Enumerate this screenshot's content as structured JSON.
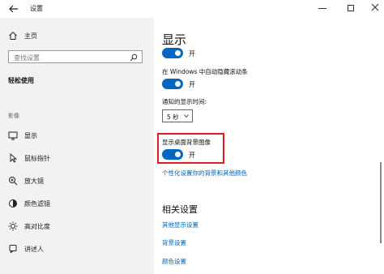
{
  "window": {
    "title": "设置"
  },
  "sidebar": {
    "home_label": "主页",
    "search_placeholder": "查找设置",
    "section_title": "轻松使用",
    "group_label": "影像",
    "items": [
      {
        "label": "显示",
        "icon": "monitor-icon"
      },
      {
        "label": "鼠标指针",
        "icon": "mouse-pointer-icon"
      },
      {
        "label": "放大镜",
        "icon": "magnifier-icon"
      },
      {
        "label": "颜色滤镜",
        "icon": "color-filter-icon"
      },
      {
        "label": "高对比度",
        "icon": "contrast-icon"
      },
      {
        "label": "讲述人",
        "icon": "narrator-icon"
      }
    ]
  },
  "main": {
    "title": "显示",
    "toggle1_state": "开",
    "scrollbar_setting_label": "在 Windows 中自动隐藏滚动条",
    "toggle2_state": "开",
    "notification_label": "通知的显示时间:",
    "notification_value": "5 秒",
    "background_label": "显示桌面背景图像",
    "toggle3_state": "开",
    "personalize_link": "个性化设置你的背景和其他颜色",
    "related_title": "相关设置",
    "related_links": [
      "其他显示设置",
      "背景设置",
      "颜色设置"
    ]
  },
  "colors": {
    "accent": "#0067c0",
    "link": "#0063b1",
    "highlight_border": "#e01b24",
    "sidebar_bg": "#f2f2f2"
  }
}
